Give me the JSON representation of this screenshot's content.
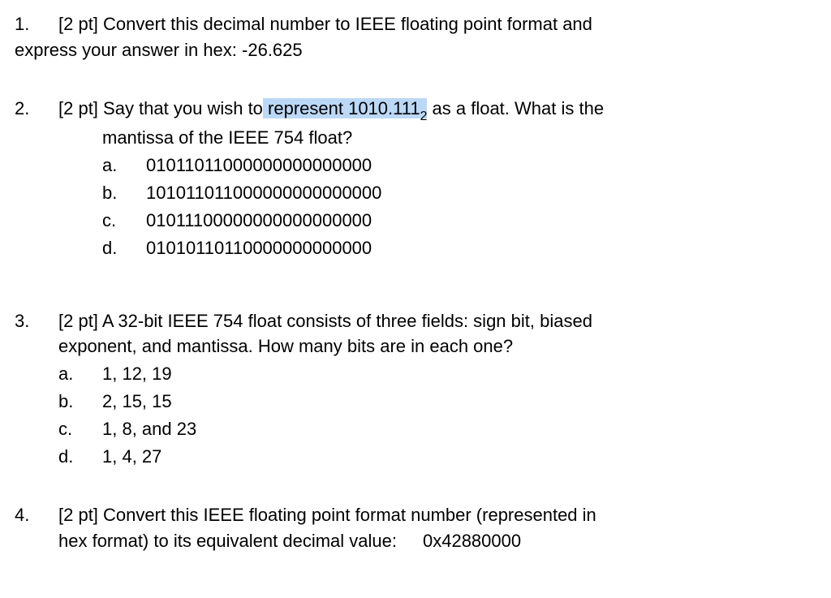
{
  "q1": {
    "number": "1.",
    "line1_prefix": "[2 pt] Convert this decimal number to IEEE floating point format and",
    "line2": "express your answer in hex: -26.625"
  },
  "q2": {
    "number": "2.",
    "line1_a": "[2 pt] Say that you wish to",
    "line1_highlight": " represent 1010.111",
    "line1_sub": "2",
    "line1_b": " as a float. What is the",
    "line2": "mantissa of the IEEE 754 float?",
    "options": [
      {
        "letter": "a.",
        "text": "01011011000000000000000"
      },
      {
        "letter": "b.",
        "text": "101011011000000000000000"
      },
      {
        "letter": "c.",
        "text": "01011100000000000000000"
      },
      {
        "letter": "d.",
        "text": "01010110110000000000000"
      }
    ]
  },
  "q3": {
    "number": "3.",
    "line1": "[2 pt] A 32-bit IEEE 754 float consists of three fields: sign bit, biased",
    "line2": "exponent, and mantissa. How many bits are in each one?",
    "options": [
      {
        "letter": "a.",
        "text": "1, 12, 19"
      },
      {
        "letter": "b.",
        "text": "2, 15, 15"
      },
      {
        "letter": "c.",
        "text": "1, 8, and 23"
      },
      {
        "letter": "d.",
        "text": "1, 4, 27"
      }
    ]
  },
  "q4": {
    "number": "4.",
    "line1": "[2 pt] Convert this IEEE floating point format number (represented in",
    "line2a": "hex format) to its equivalent decimal value:",
    "line2_value": "0x42880000"
  }
}
